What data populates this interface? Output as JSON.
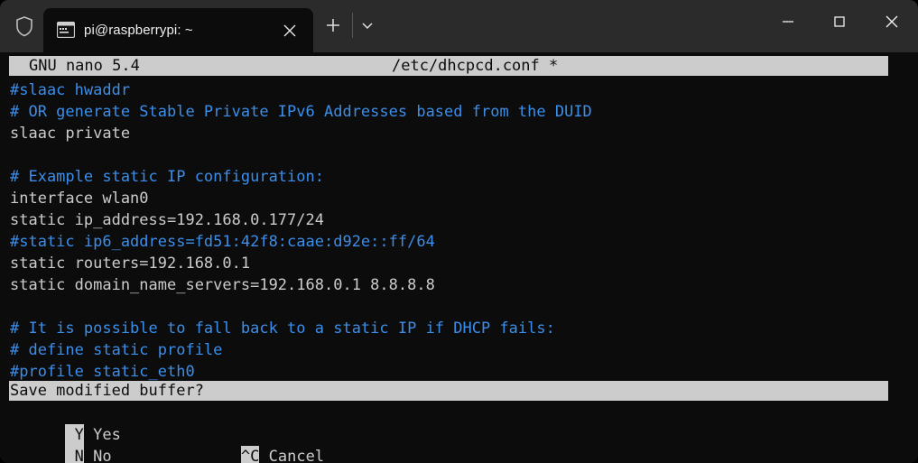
{
  "window": {
    "chrome_bg": "#2b2b2b",
    "terminal_bg": "#0c0c0c",
    "shield_icon": "shield-icon"
  },
  "titlebar": {
    "tabs": [
      {
        "title": "pi@raspberrypi: ~",
        "icon": "terminal-icon",
        "close_icon": "close-icon",
        "active": true
      }
    ],
    "new_tab_icon": "plus-icon",
    "dropdown_icon": "chevron-down-icon",
    "controls": {
      "minimize_icon": "minimize-icon",
      "maximize_icon": "maximize-icon",
      "close_icon": "close-icon"
    }
  },
  "nano": {
    "header": {
      "version": "GNU nano 5.4",
      "filename": "/etc/dhcpcd.conf *"
    },
    "colors": {
      "comment": "#3b8eea",
      "default_fg": "#cccccc",
      "reverse_bg": "#cccccc",
      "reverse_fg": "#0c0c0c"
    },
    "buffer_lines": [
      {
        "text": "#slaac hwaddr",
        "style": "comment"
      },
      {
        "text": "# OR generate Stable Private IPv6 Addresses based from the DUID",
        "style": "comment"
      },
      {
        "text": "slaac private",
        "style": "default"
      },
      {
        "text": "",
        "style": "default"
      },
      {
        "text": "# Example static IP configuration:",
        "style": "comment"
      },
      {
        "text": "interface wlan0",
        "style": "default"
      },
      {
        "text": "static ip_address=192.168.0.177/24",
        "style": "default"
      },
      {
        "text": "#static ip6_address=fd51:42f8:caae:d92e::ff/64",
        "style": "comment"
      },
      {
        "text": "static routers=192.168.0.1",
        "style": "default"
      },
      {
        "text": "static domain_name_servers=192.168.0.1 8.8.8.8",
        "style": "default"
      },
      {
        "text": "",
        "style": "default"
      },
      {
        "text": "# It is possible to fall back to a static IP if DHCP fails:",
        "style": "comment"
      },
      {
        "text": "# define static profile",
        "style": "comment"
      },
      {
        "text": "#profile static_eth0",
        "style": "comment"
      }
    ],
    "prompt": {
      "question": "Save modified buffer?",
      "shortcuts_row1": [
        {
          "key": " Y",
          "label": " Yes"
        }
      ],
      "shortcuts_row2": [
        {
          "key": " N",
          "label": " No"
        },
        {
          "key": "^C",
          "label": " Cancel"
        }
      ],
      "row2_key_gap": "              "
    }
  }
}
